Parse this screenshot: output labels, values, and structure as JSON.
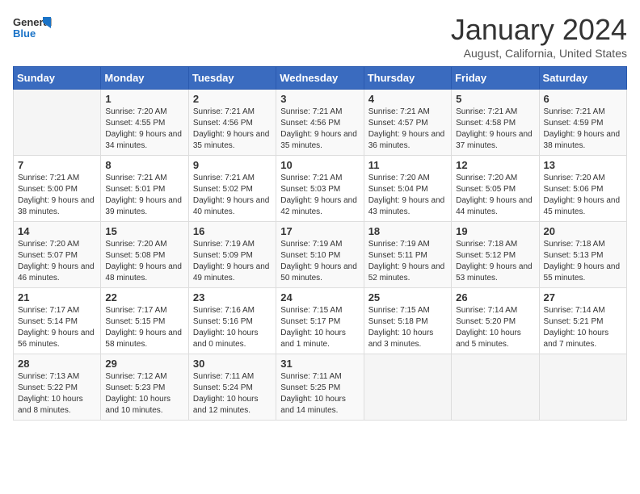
{
  "logo": {
    "line1": "General",
    "line2": "Blue"
  },
  "title": "January 2024",
  "subtitle": "August, California, United States",
  "days_of_week": [
    "Sunday",
    "Monday",
    "Tuesday",
    "Wednesday",
    "Thursday",
    "Friday",
    "Saturday"
  ],
  "weeks": [
    [
      {
        "day": "",
        "sunrise": "",
        "sunset": "",
        "daylight": ""
      },
      {
        "day": "1",
        "sunrise": "Sunrise: 7:20 AM",
        "sunset": "Sunset: 4:55 PM",
        "daylight": "Daylight: 9 hours and 34 minutes."
      },
      {
        "day": "2",
        "sunrise": "Sunrise: 7:21 AM",
        "sunset": "Sunset: 4:56 PM",
        "daylight": "Daylight: 9 hours and 35 minutes."
      },
      {
        "day": "3",
        "sunrise": "Sunrise: 7:21 AM",
        "sunset": "Sunset: 4:56 PM",
        "daylight": "Daylight: 9 hours and 35 minutes."
      },
      {
        "day": "4",
        "sunrise": "Sunrise: 7:21 AM",
        "sunset": "Sunset: 4:57 PM",
        "daylight": "Daylight: 9 hours and 36 minutes."
      },
      {
        "day": "5",
        "sunrise": "Sunrise: 7:21 AM",
        "sunset": "Sunset: 4:58 PM",
        "daylight": "Daylight: 9 hours and 37 minutes."
      },
      {
        "day": "6",
        "sunrise": "Sunrise: 7:21 AM",
        "sunset": "Sunset: 4:59 PM",
        "daylight": "Daylight: 9 hours and 38 minutes."
      }
    ],
    [
      {
        "day": "7",
        "sunrise": "Sunrise: 7:21 AM",
        "sunset": "Sunset: 5:00 PM",
        "daylight": "Daylight: 9 hours and 38 minutes."
      },
      {
        "day": "8",
        "sunrise": "Sunrise: 7:21 AM",
        "sunset": "Sunset: 5:01 PM",
        "daylight": "Daylight: 9 hours and 39 minutes."
      },
      {
        "day": "9",
        "sunrise": "Sunrise: 7:21 AM",
        "sunset": "Sunset: 5:02 PM",
        "daylight": "Daylight: 9 hours and 40 minutes."
      },
      {
        "day": "10",
        "sunrise": "Sunrise: 7:21 AM",
        "sunset": "Sunset: 5:03 PM",
        "daylight": "Daylight: 9 hours and 42 minutes."
      },
      {
        "day": "11",
        "sunrise": "Sunrise: 7:20 AM",
        "sunset": "Sunset: 5:04 PM",
        "daylight": "Daylight: 9 hours and 43 minutes."
      },
      {
        "day": "12",
        "sunrise": "Sunrise: 7:20 AM",
        "sunset": "Sunset: 5:05 PM",
        "daylight": "Daylight: 9 hours and 44 minutes."
      },
      {
        "day": "13",
        "sunrise": "Sunrise: 7:20 AM",
        "sunset": "Sunset: 5:06 PM",
        "daylight": "Daylight: 9 hours and 45 minutes."
      }
    ],
    [
      {
        "day": "14",
        "sunrise": "Sunrise: 7:20 AM",
        "sunset": "Sunset: 5:07 PM",
        "daylight": "Daylight: 9 hours and 46 minutes."
      },
      {
        "day": "15",
        "sunrise": "Sunrise: 7:20 AM",
        "sunset": "Sunset: 5:08 PM",
        "daylight": "Daylight: 9 hours and 48 minutes."
      },
      {
        "day": "16",
        "sunrise": "Sunrise: 7:19 AM",
        "sunset": "Sunset: 5:09 PM",
        "daylight": "Daylight: 9 hours and 49 minutes."
      },
      {
        "day": "17",
        "sunrise": "Sunrise: 7:19 AM",
        "sunset": "Sunset: 5:10 PM",
        "daylight": "Daylight: 9 hours and 50 minutes."
      },
      {
        "day": "18",
        "sunrise": "Sunrise: 7:19 AM",
        "sunset": "Sunset: 5:11 PM",
        "daylight": "Daylight: 9 hours and 52 minutes."
      },
      {
        "day": "19",
        "sunrise": "Sunrise: 7:18 AM",
        "sunset": "Sunset: 5:12 PM",
        "daylight": "Daylight: 9 hours and 53 minutes."
      },
      {
        "day": "20",
        "sunrise": "Sunrise: 7:18 AM",
        "sunset": "Sunset: 5:13 PM",
        "daylight": "Daylight: 9 hours and 55 minutes."
      }
    ],
    [
      {
        "day": "21",
        "sunrise": "Sunrise: 7:17 AM",
        "sunset": "Sunset: 5:14 PM",
        "daylight": "Daylight: 9 hours and 56 minutes."
      },
      {
        "day": "22",
        "sunrise": "Sunrise: 7:17 AM",
        "sunset": "Sunset: 5:15 PM",
        "daylight": "Daylight: 9 hours and 58 minutes."
      },
      {
        "day": "23",
        "sunrise": "Sunrise: 7:16 AM",
        "sunset": "Sunset: 5:16 PM",
        "daylight": "Daylight: 10 hours and 0 minutes."
      },
      {
        "day": "24",
        "sunrise": "Sunrise: 7:15 AM",
        "sunset": "Sunset: 5:17 PM",
        "daylight": "Daylight: 10 hours and 1 minute."
      },
      {
        "day": "25",
        "sunrise": "Sunrise: 7:15 AM",
        "sunset": "Sunset: 5:18 PM",
        "daylight": "Daylight: 10 hours and 3 minutes."
      },
      {
        "day": "26",
        "sunrise": "Sunrise: 7:14 AM",
        "sunset": "Sunset: 5:20 PM",
        "daylight": "Daylight: 10 hours and 5 minutes."
      },
      {
        "day": "27",
        "sunrise": "Sunrise: 7:14 AM",
        "sunset": "Sunset: 5:21 PM",
        "daylight": "Daylight: 10 hours and 7 minutes."
      }
    ],
    [
      {
        "day": "28",
        "sunrise": "Sunrise: 7:13 AM",
        "sunset": "Sunset: 5:22 PM",
        "daylight": "Daylight: 10 hours and 8 minutes."
      },
      {
        "day": "29",
        "sunrise": "Sunrise: 7:12 AM",
        "sunset": "Sunset: 5:23 PM",
        "daylight": "Daylight: 10 hours and 10 minutes."
      },
      {
        "day": "30",
        "sunrise": "Sunrise: 7:11 AM",
        "sunset": "Sunset: 5:24 PM",
        "daylight": "Daylight: 10 hours and 12 minutes."
      },
      {
        "day": "31",
        "sunrise": "Sunrise: 7:11 AM",
        "sunset": "Sunset: 5:25 PM",
        "daylight": "Daylight: 10 hours and 14 minutes."
      },
      {
        "day": "",
        "sunrise": "",
        "sunset": "",
        "daylight": ""
      },
      {
        "day": "",
        "sunrise": "",
        "sunset": "",
        "daylight": ""
      },
      {
        "day": "",
        "sunrise": "",
        "sunset": "",
        "daylight": ""
      }
    ]
  ]
}
